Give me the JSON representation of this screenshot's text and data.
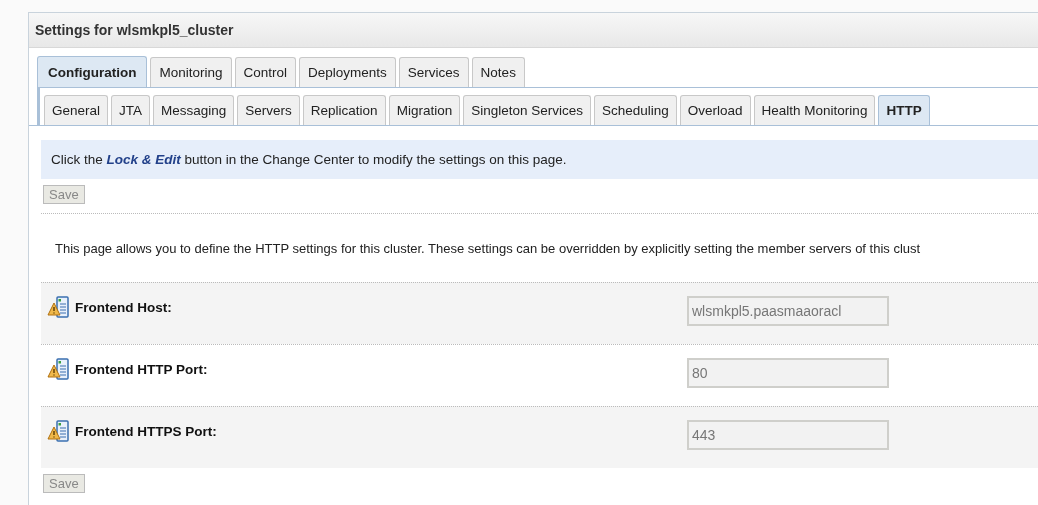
{
  "panel": {
    "title": "Settings for wlsmkpl5_cluster"
  },
  "tabs": [
    {
      "label": "Configuration",
      "selected": true
    },
    {
      "label": "Monitoring",
      "selected": false
    },
    {
      "label": "Control",
      "selected": false
    },
    {
      "label": "Deployments",
      "selected": false
    },
    {
      "label": "Services",
      "selected": false
    },
    {
      "label": "Notes",
      "selected": false
    }
  ],
  "subtabs": [
    {
      "label": "General",
      "selected": false
    },
    {
      "label": "JTA",
      "selected": false
    },
    {
      "label": "Messaging",
      "selected": false
    },
    {
      "label": "Servers",
      "selected": false
    },
    {
      "label": "Replication",
      "selected": false
    },
    {
      "label": "Migration",
      "selected": false
    },
    {
      "label": "Singleton Services",
      "selected": false
    },
    {
      "label": "Scheduling",
      "selected": false
    },
    {
      "label": "Overload",
      "selected": false
    },
    {
      "label": "Health Monitoring",
      "selected": false
    },
    {
      "label": "HTTP",
      "selected": true
    }
  ],
  "message": "Click the **Lock & Edit** button in the Change Center to modify the settings on this page.",
  "save_top": {
    "label": "Save",
    "disabled": true
  },
  "description": "This page allows you to define the HTTP settings for this cluster. These settings can be overridden by explicitly setting the member servers of this clust",
  "fields": [
    {
      "label": "Frontend Host:",
      "value": "wlsmkpl5.paasmaaoracl",
      "disabled": true
    },
    {
      "label": "Frontend HTTP Port:",
      "value": "80",
      "disabled": true
    },
    {
      "label": "Frontend HTTPS Port:",
      "value": "443",
      "disabled": true
    }
  ],
  "save_bottom": {
    "label": "Save",
    "disabled": true
  }
}
